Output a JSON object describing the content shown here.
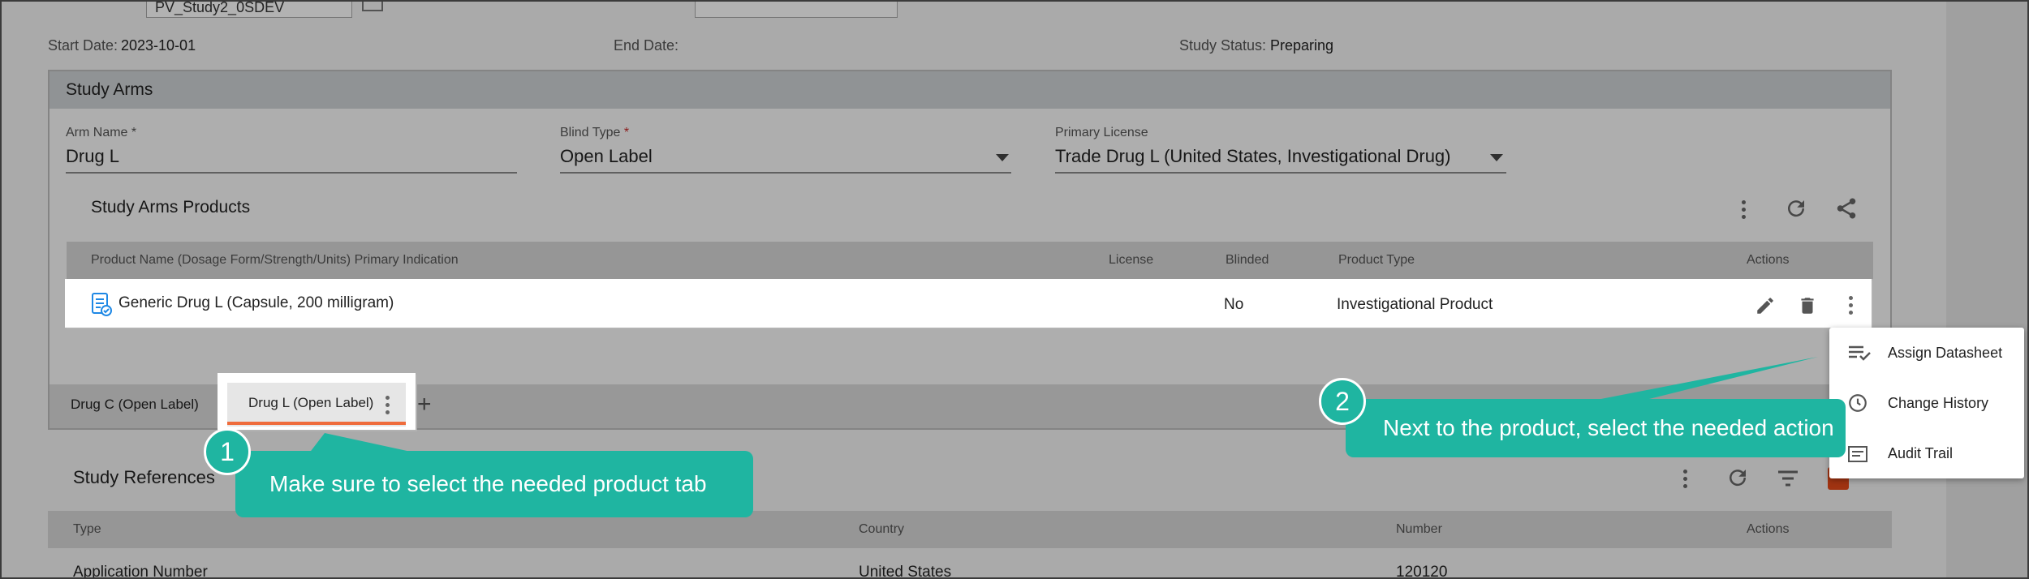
{
  "top": {
    "study_id_value": "PV_Study2_0SDEV",
    "start_date_label": "Start Date:",
    "start_date_value": "2023-10-01",
    "end_date_label": "End Date:",
    "end_date_value": "",
    "status_label": "Study Status:",
    "status_value": "Preparing"
  },
  "study_arms": {
    "title": "Study Arms",
    "arm_name_label": "Arm Name *",
    "arm_name_value": "Drug L",
    "blind_type_label": "Blind Type ",
    "blind_type_required": "*",
    "blind_type_value": "Open Label",
    "primary_license_label": "Primary License",
    "primary_license_value": "Trade Drug L (United States, Investigational Drug)"
  },
  "products": {
    "title": "Study Arms Products",
    "columns": [
      "Product Name (Dosage Form/Strength/Units) Primary Indication",
      "License",
      "Blinded",
      "Product Type",
      "Actions"
    ],
    "rows": [
      {
        "name": "Generic Drug L (Capsule, 200 milligram)",
        "license": "",
        "blinded": "No",
        "type": "Investigational Product"
      }
    ]
  },
  "tabs": [
    {
      "label": "Drug C (Open Label)"
    },
    {
      "label": "Drug L (Open Label)"
    }
  ],
  "tab_add": "+",
  "references": {
    "title": "Study References",
    "columns": [
      "Type",
      "Country",
      "Number",
      "Actions"
    ],
    "rows": [
      {
        "type": "Application Number",
        "country": "United States",
        "number": "120120"
      }
    ]
  },
  "menu": {
    "items": [
      {
        "label": "Assign Datasheet",
        "icon": "assign-datasheet-icon"
      },
      {
        "label": "Change History",
        "icon": "history-icon"
      },
      {
        "label": "Audit Trail",
        "icon": "audit-trail-icon"
      }
    ]
  },
  "callouts": [
    {
      "number": "1",
      "text": "Make sure to select the needed product tab"
    },
    {
      "number": "2",
      "text": "Next to the product, select the needed action"
    }
  ],
  "colors": {
    "callout": "#1fb5a1",
    "tab_underline": "#ef6c3c",
    "required": "#c62828"
  }
}
